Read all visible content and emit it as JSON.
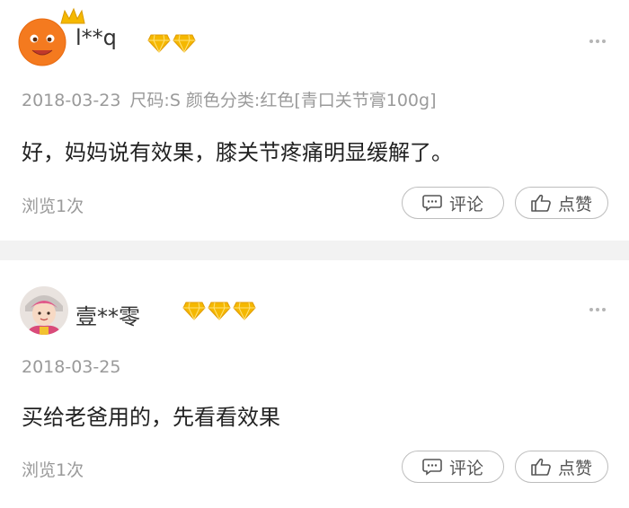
{
  "reviews": [
    {
      "username": "l**q",
      "gem_count": 2,
      "date": "2018-03-23",
      "spec": "尺码:S 颜色分类:红色[青口关节膏100g]",
      "content": "好，妈妈说有效果，膝关节疼痛明显缓解了。",
      "views": "浏览1次",
      "comment_label": "评论",
      "like_label": "点赞"
    },
    {
      "username": "壹**零",
      "gem_count": 3,
      "date": "2018-03-25",
      "spec": "",
      "content": "买给老爸用的，先看看效果",
      "views": "浏览1次",
      "comment_label": "评论",
      "like_label": "点赞"
    }
  ],
  "colors": {
    "gem_gold": "#f5b800",
    "muted_text": "#9a9a9a",
    "separator": "#f2f2f2",
    "button_border": "#bdbdbd"
  },
  "icons": {
    "more": "more-dots-icon",
    "comment": "comment-bubble-icon",
    "like": "thumbs-up-icon",
    "gem": "diamond-gem-icon",
    "crown": "crown-icon"
  }
}
